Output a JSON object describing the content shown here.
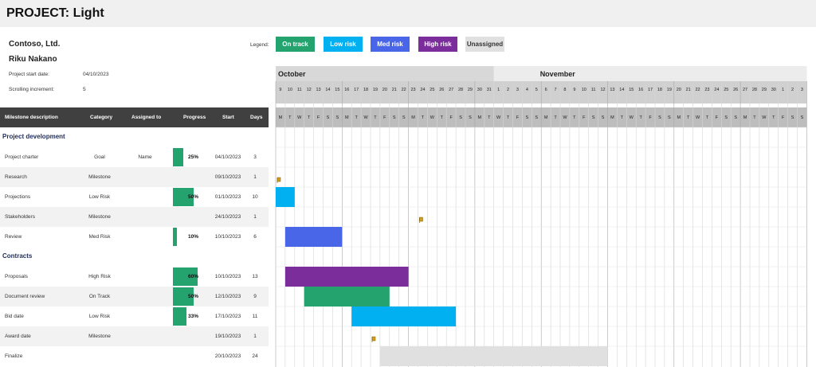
{
  "project": {
    "title": "PROJECT: Light",
    "company": "Contoso, Ltd.",
    "manager": "Riku Nakano",
    "start_date_label": "Project start date:",
    "start_date_value": "04/10/2023",
    "increment_label": "Scrolling increment:",
    "increment_value": "5"
  },
  "legend": {
    "label": "Legend:",
    "items": [
      {
        "label": "On track",
        "color": "#24a36f",
        "text_color": "#ffffff"
      },
      {
        "label": "Low risk",
        "color": "#00b0f0",
        "text_color": "#ffffff"
      },
      {
        "label": "Med risk",
        "color": "#4a66e8",
        "text_color": "#ffffff"
      },
      {
        "label": "High risk",
        "color": "#7b2d9c",
        "text_color": "#ffffff"
      },
      {
        "label": "Unassigned",
        "color": "#e0e0e0",
        "text_color": "#333333"
      }
    ]
  },
  "columns": {
    "milestone": "Milestone description",
    "category": "Category",
    "assigned": "Assigned to",
    "progress": "Progress",
    "start": "Start",
    "days": "Days"
  },
  "sections": [
    {
      "title": "Project development",
      "tasks": [
        {
          "name": "Project charter",
          "category": "Goal",
          "assigned": "Name",
          "progress": "25%",
          "progress_value": 25,
          "start": "04/10/2023",
          "days": "3",
          "bar": "none"
        },
        {
          "name": "Research",
          "category": "Milestone",
          "assigned": "",
          "progress": "",
          "progress_value": 0,
          "start": "09/10/2023",
          "days": "1",
          "bar": "milestone"
        },
        {
          "name": "Projections",
          "category": "Low Risk",
          "assigned": "",
          "progress": "50%",
          "progress_value": 50,
          "start": "01/10/2023",
          "days": "10",
          "bar": "low"
        },
        {
          "name": "Stakeholders",
          "category": "Milestone",
          "assigned": "",
          "progress": "",
          "progress_value": 0,
          "start": "24/10/2023",
          "days": "1",
          "bar": "milestone"
        },
        {
          "name": "Review",
          "category": "Med Risk",
          "assigned": "",
          "progress": "10%",
          "progress_value": 10,
          "start": "10/10/2023",
          "days": "6",
          "bar": "med"
        }
      ]
    },
    {
      "title": "Contracts",
      "tasks": [
        {
          "name": "Proposals",
          "category": "High Risk",
          "assigned": "",
          "progress": "60%",
          "progress_value": 60,
          "start": "10/10/2023",
          "days": "13",
          "bar": "high"
        },
        {
          "name": "Document review",
          "category": "On Track",
          "assigned": "",
          "progress": "50%",
          "progress_value": 50,
          "start": "12/10/2023",
          "days": "9",
          "bar": "ontrack"
        },
        {
          "name": "Bid date",
          "category": "Low Risk",
          "assigned": "",
          "progress": "33%",
          "progress_value": 33,
          "start": "17/10/2023",
          "days": "11",
          "bar": "low"
        },
        {
          "name": "Award date",
          "category": "Milestone",
          "assigned": "",
          "progress": "",
          "progress_value": 0,
          "start": "19/10/2023",
          "days": "1",
          "bar": "milestone"
        },
        {
          "name": "Finalize",
          "category": "",
          "assigned": "",
          "progress": "",
          "progress_value": 0,
          "start": "20/10/2023",
          "days": "24",
          "bar": "unassigned"
        }
      ]
    }
  ],
  "timeline": {
    "first_date": "2023-10-09",
    "num_days": 56,
    "months": [
      {
        "label": "October",
        "start_index": 0
      },
      {
        "label": "November",
        "start_index": 23
      }
    ],
    "weekday_letters": [
      "M",
      "T",
      "W",
      "T",
      "F",
      "S",
      "S"
    ],
    "bar_colors": {
      "ontrack": "#24a36f",
      "low": "#00b0f0",
      "med": "#4a66e8",
      "high": "#7b2d9c",
      "unassigned": "#e0e0e0",
      "milestone": "#d4a017"
    }
  }
}
